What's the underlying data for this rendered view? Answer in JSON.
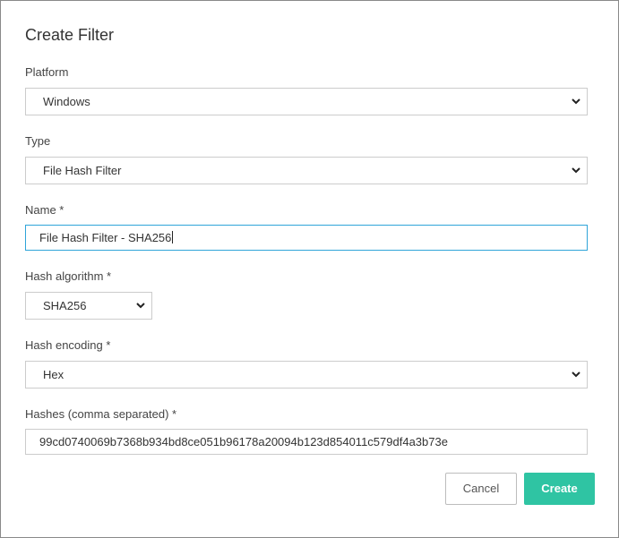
{
  "dialog": {
    "title": "Create Filter"
  },
  "form": {
    "platform": {
      "label": "Platform",
      "value": "Windows"
    },
    "type": {
      "label": "Type",
      "value": "File Hash Filter"
    },
    "name": {
      "label": "Name *",
      "value": "File Hash Filter - SHA256"
    },
    "hash_algorithm": {
      "label": "Hash algorithm *",
      "value": "SHA256"
    },
    "hash_encoding": {
      "label": "Hash encoding *",
      "value": "Hex"
    },
    "hashes": {
      "label": "Hashes (comma separated) *",
      "value": "99cd0740069b7368b934bd8ce051b96178a20094b123d854011c579df4a3b73e"
    }
  },
  "actions": {
    "cancel_label": "Cancel",
    "create_label": "Create"
  },
  "colors": {
    "accent": "#2fc4a3",
    "focus_border": "#2fa4d9",
    "border": "#cccccc"
  },
  "icons": {
    "dropdown": "chevron-down-icon"
  }
}
